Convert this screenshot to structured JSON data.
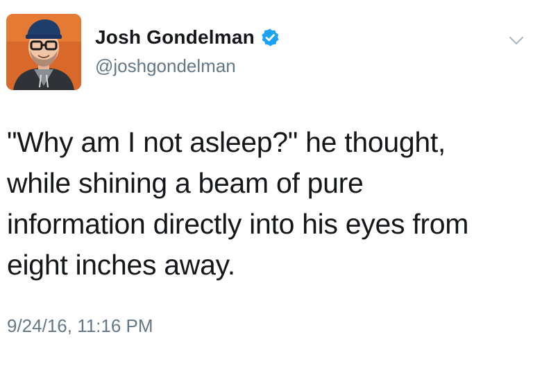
{
  "tweet": {
    "author": {
      "display_name": "Josh Gondelman",
      "handle": "@joshgondelman",
      "verified": true,
      "avatar_icon": "profile-photo"
    },
    "text": "\"Why am I not asleep?\" he thought,\nwhile shining a beam of pure\ninformation directly into his eyes from\neight inches away.",
    "timestamp": "9/24/16, 11:16 PM",
    "menu_icon": "chevron-down-icon"
  },
  "colors": {
    "verified_blue": "#1da1f2",
    "secondary_text": "#657786",
    "primary_text": "#14171a",
    "avatar_background": "#d9692a"
  }
}
